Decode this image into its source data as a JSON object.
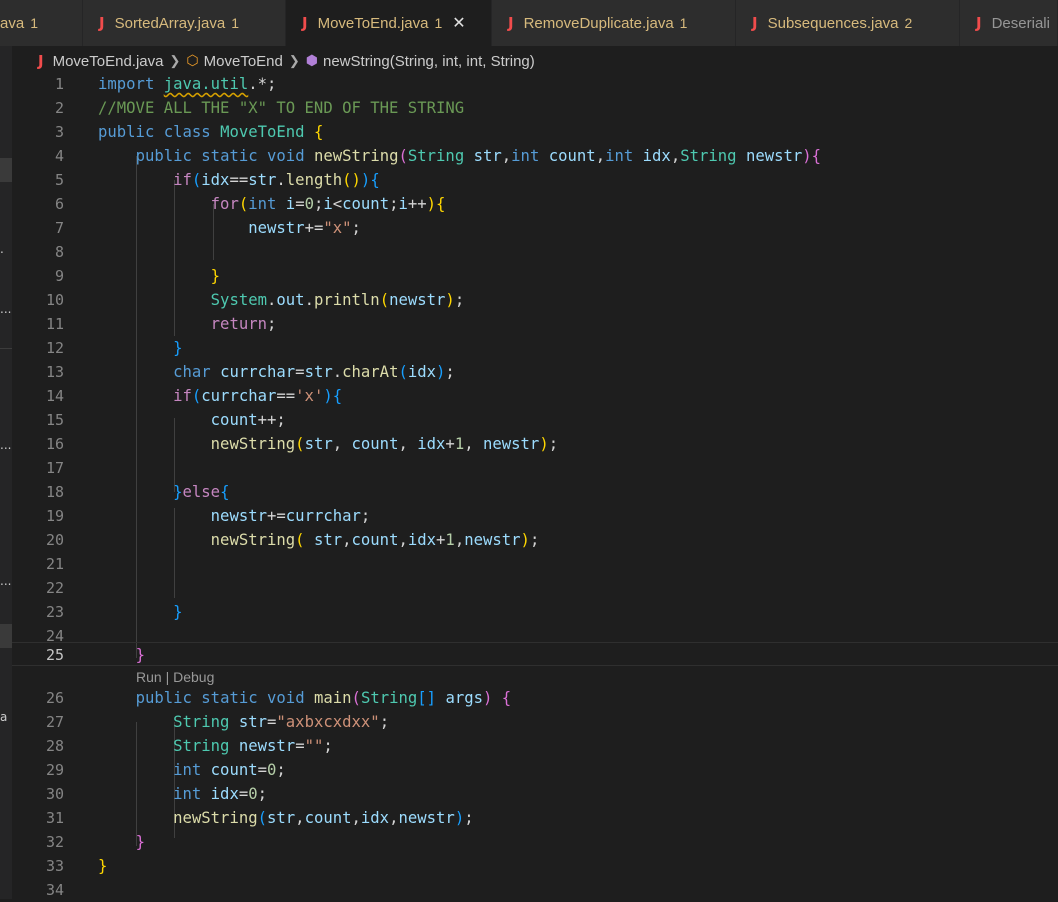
{
  "tabs": [
    {
      "label": "ava",
      "problems": "1"
    },
    {
      "label": "SortedArray.java",
      "problems": "1"
    },
    {
      "label": "MoveToEnd.java",
      "problems": "1",
      "active": true
    },
    {
      "label": "RemoveDuplicate.java",
      "problems": "1"
    },
    {
      "label": "Subsequences.java",
      "problems": "2"
    },
    {
      "label": "Deseriali"
    }
  ],
  "breadcrumb": {
    "file": "MoveToEnd.java",
    "class": "MoveToEnd",
    "method": "newString(String, int, int, String)"
  },
  "codelens": "Run | Debug",
  "sidebar_fragments": [
    ".",
    "...",
    "...",
    "...",
    "a"
  ],
  "line_numbers": [
    "1",
    "2",
    "3",
    "4",
    "5",
    "6",
    "7",
    "8",
    "9",
    "10",
    "11",
    "12",
    "13",
    "14",
    "15",
    "16",
    "17",
    "18",
    "19",
    "20",
    "21",
    "22",
    "23",
    "24",
    "25",
    "26",
    "27",
    "28",
    "29",
    "30",
    "31",
    "32",
    "33",
    "34"
  ],
  "code": {
    "l1": {
      "kw_import": "import",
      "pkg": "java.util",
      "rest": ".*;"
    },
    "l2": {
      "comment": "//MOVE ALL THE \"X\" TO END OF THE STRING"
    },
    "l3": {
      "kw_public": "public",
      "kw_class": "class",
      "name": "MoveToEnd",
      "brace": "{"
    },
    "l4": {
      "kw_public": "public",
      "kw_static": "static",
      "kw_void": "void",
      "name": "newString",
      "open": "(",
      "t1": "String",
      "p1": "str",
      "c1": ",",
      "t2": "int",
      "p2": "count",
      "c2": ",",
      "t3": "int",
      "p3": "idx",
      "c3": ",",
      "t4": "String",
      "p4": "newstr",
      "close": ")",
      "brace": "{"
    },
    "l5": {
      "kw_if": "if",
      "open": "(",
      "a": "idx",
      "op": "==",
      "b": "str",
      "dot": ".",
      "fn": "length",
      "call": "()",
      "close": ")",
      "brace": "{"
    },
    "l6": {
      "kw_for": "for",
      "open": "(",
      "kw_int": "int",
      "v": "i",
      "init": "=",
      "zero": "0",
      "semi1": ";",
      "v2": "i",
      "lt": "<",
      "v3": "count",
      "semi2": ";",
      "v4": "i",
      "inc": "++",
      "close": ")",
      "brace": "{"
    },
    "l7": {
      "v": "newstr",
      "op": "+=",
      "s": "\"x\"",
      "semi": ";"
    },
    "l9": {
      "brace": "}"
    },
    "l10": {
      "cls": "System",
      "dot1": ".",
      "field": "out",
      "dot2": ".",
      "fn": "println",
      "open": "(",
      "v": "newstr",
      "close": ")",
      "semi": ";"
    },
    "l11": {
      "kw_return": "return",
      "semi": ";"
    },
    "l12": {
      "brace": "}"
    },
    "l13": {
      "kw_char": "char",
      "v": "currchar",
      "eq": "=",
      "obj": "str",
      "dot": ".",
      "fn": "charAt",
      "open": "(",
      "arg": "idx",
      "close": ")",
      "semi": ";"
    },
    "l14": {
      "kw_if": "if",
      "open": "(",
      "v": "currchar",
      "op": "==",
      "s": "'x'",
      "close": ")",
      "brace": "{"
    },
    "l15": {
      "v": "count",
      "op": "++;"
    },
    "l16": {
      "fn": "newString",
      "open": "(",
      "a1": "str",
      "c1": ", ",
      "a2": "count",
      "c2": ", ",
      "a3": "idx",
      "plus": "+",
      "one": "1",
      "c3": ", ",
      "a4": "newstr",
      "close": ")",
      "semi": ";"
    },
    "l18": {
      "brace_close": "}",
      "kw_else": "else",
      "brace_open": "{"
    },
    "l19": {
      "v": "newstr",
      "op": "+=",
      "v2": "currchar",
      "semi": ";"
    },
    "l20": {
      "fn": "newString",
      "open": "( ",
      "a1": "str",
      "c1": ",",
      "a2": "count",
      "c2": ",",
      "a3": "idx",
      "plus": "+",
      "one": "1",
      "c3": ",",
      "a4": "newstr",
      "close": ")",
      "semi": ";"
    },
    "l23": {
      "brace": "}"
    },
    "l25": {
      "brace": "}"
    },
    "l26": {
      "kw_public": "public",
      "kw_static": "static",
      "kw_void": "void",
      "name": "main",
      "open": "(",
      "type": "String",
      "arr": "[]",
      "param": "args",
      "close": ")",
      "brace": "{"
    },
    "l27": {
      "type": "String",
      "v": "str",
      "eq": "=",
      "s": "\"axbxcxdxx\"",
      "semi": ";"
    },
    "l28": {
      "type": "String",
      "v": "newstr",
      "eq": "=",
      "s": "\"\"",
      "semi": ";"
    },
    "l29": {
      "kw_int": "int",
      "v": "count",
      "eq": "=",
      "n": "0",
      "semi": ";"
    },
    "l30": {
      "kw_int": "int",
      "v": "idx",
      "eq": "=",
      "n": "0",
      "semi": ";"
    },
    "l31": {
      "fn": "newString",
      "open": "(",
      "a1": "str",
      "c1": ",",
      "a2": "count",
      "c2": ",",
      "a3": "idx",
      "c3": ",",
      "a4": "newstr",
      "close": ")",
      "semi": ";"
    },
    "l32": {
      "brace": "}"
    },
    "l33": {
      "brace": "}"
    }
  },
  "colors": {
    "editor_bg": "#1e1e1e",
    "tab_bg": "#2d2d2d",
    "keyword": "#569cd6",
    "control": "#c586c0",
    "type": "#4ec9b0",
    "function": "#dcdcaa",
    "variable": "#9cdcfe",
    "string": "#ce9178",
    "number": "#b5cea8",
    "comment": "#6a9955",
    "java_icon": "#f14c4c"
  }
}
